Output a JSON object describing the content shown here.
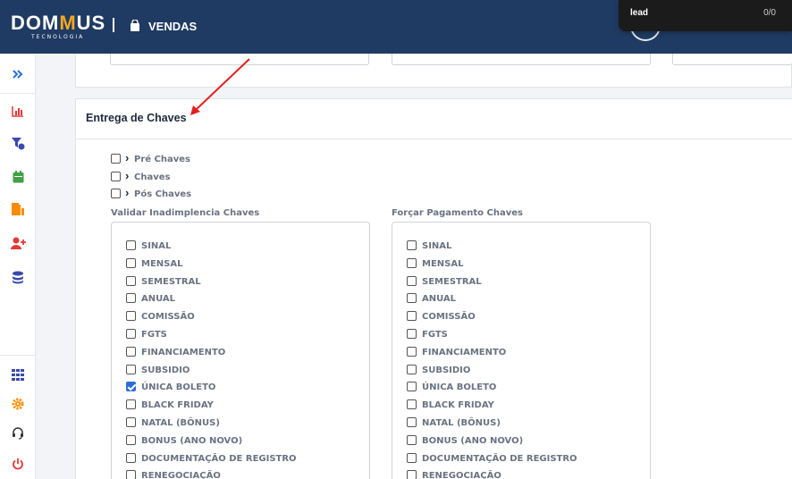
{
  "header": {
    "logo_main": "DOMMUS",
    "logo_sub": "TECNOLOGIA",
    "module_title": "VENDAS",
    "lead_popup": {
      "label": "lead",
      "count": "0/0"
    }
  },
  "sidebar": {
    "items": [
      {
        "icon": "chevron-double-right-icon",
        "color": "#2b6fd6"
      },
      {
        "icon": "bar-chart-icon",
        "color": "#e53935"
      },
      {
        "icon": "funnel-icon",
        "color": "#3949ab"
      },
      {
        "icon": "calendar-icon",
        "color": "#43a047"
      },
      {
        "icon": "door-icon",
        "color": "#fb8c00"
      },
      {
        "icon": "user-plus-icon",
        "color": "#e53935"
      },
      {
        "icon": "database-icon",
        "color": "#3949ab"
      },
      {
        "icon": "grid-icon",
        "color": "#3949ab"
      },
      {
        "icon": "gear-icon",
        "color": "#fb8c00"
      },
      {
        "icon": "headset-icon",
        "color": "#333333"
      },
      {
        "icon": "power-icon",
        "color": "#e53935"
      }
    ]
  },
  "section": {
    "title": "Entrega de Chaves",
    "stages": [
      {
        "label": "Pré Chaves",
        "checked": false
      },
      {
        "label": "Chaves",
        "checked": false
      },
      {
        "label": "Pós Chaves",
        "checked": false
      }
    ],
    "groups": [
      {
        "label": "Validar Inadimplencia Chaves",
        "options": [
          {
            "label": "SINAL",
            "checked": false
          },
          {
            "label": "MENSAL",
            "checked": false
          },
          {
            "label": "SEMESTRAL",
            "checked": false
          },
          {
            "label": "ANUAL",
            "checked": false
          },
          {
            "label": "COMISSÃO",
            "checked": false
          },
          {
            "label": "FGTS",
            "checked": false
          },
          {
            "label": "FINANCIAMENTO",
            "checked": false
          },
          {
            "label": "SUBSIDIO",
            "checked": false
          },
          {
            "label": "ÚNICA BOLETO",
            "checked": true
          },
          {
            "label": "BLACK FRIDAY",
            "checked": false
          },
          {
            "label": "NATAL (BÔNUS)",
            "checked": false
          },
          {
            "label": "BONUS (ANO NOVO)",
            "checked": false
          },
          {
            "label": "DOCUMENTAÇÃO DE REGISTRO",
            "checked": false
          },
          {
            "label": "RENEGOCIAÇÃO",
            "checked": false
          }
        ]
      },
      {
        "label": "Forçar Pagamento Chaves",
        "options": [
          {
            "label": "SINAL",
            "checked": false
          },
          {
            "label": "MENSAL",
            "checked": false
          },
          {
            "label": "SEMESTRAL",
            "checked": false
          },
          {
            "label": "ANUAL",
            "checked": false
          },
          {
            "label": "COMISSÃO",
            "checked": false
          },
          {
            "label": "FGTS",
            "checked": false
          },
          {
            "label": "FINANCIAMENTO",
            "checked": false
          },
          {
            "label": "SUBSIDIO",
            "checked": false
          },
          {
            "label": "ÚNICA BOLETO",
            "checked": false
          },
          {
            "label": "BLACK FRIDAY",
            "checked": false
          },
          {
            "label": "NATAL (BÔNUS)",
            "checked": false
          },
          {
            "label": "BONUS (ANO NOVO)",
            "checked": false
          },
          {
            "label": "DOCUMENTAÇÃO DE REGISTRO",
            "checked": false
          },
          {
            "label": "RENEGOCIAÇÃO",
            "checked": false
          }
        ]
      }
    ]
  }
}
